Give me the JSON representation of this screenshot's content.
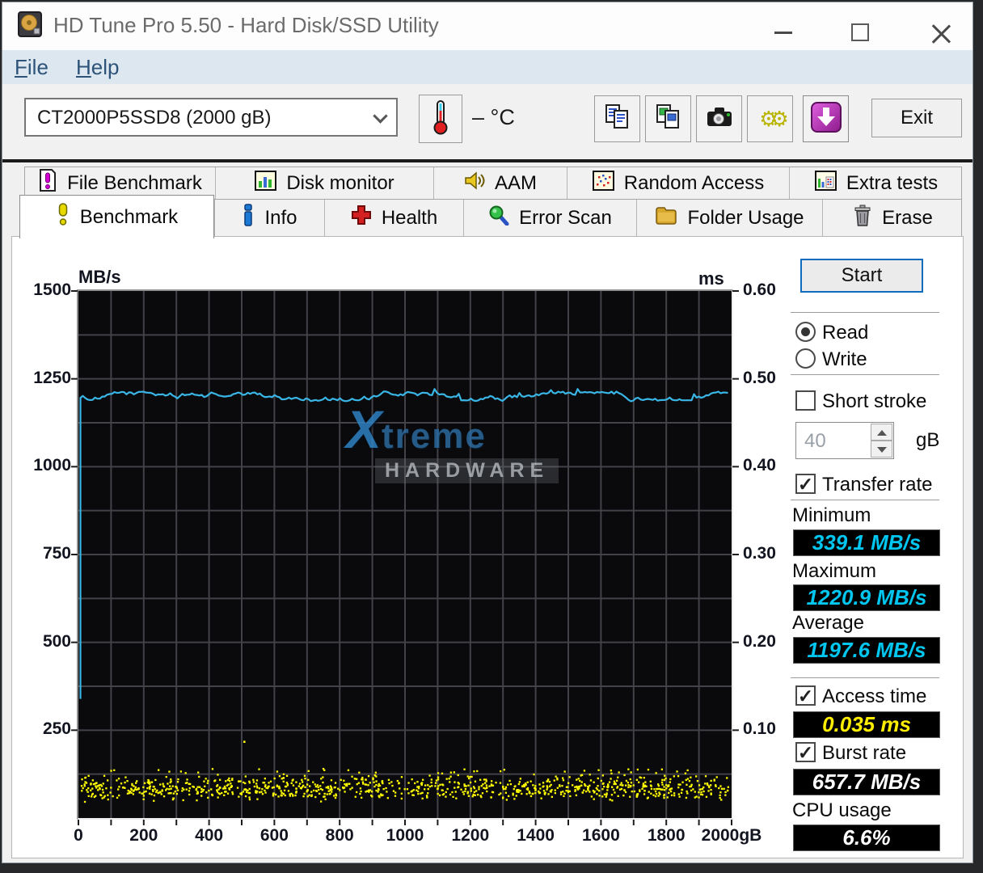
{
  "window": {
    "title": "HD Tune Pro 5.50 - Hard Disk/SSD Utility",
    "controls": [
      "minimize",
      "maximize",
      "close"
    ]
  },
  "menu": {
    "file": {
      "key": "F",
      "rest": "ile"
    },
    "help": {
      "key": "H",
      "rest": "elp"
    }
  },
  "toolbar": {
    "device": "CT2000P5SSD8 (2000 gB)",
    "temperature": "– °C",
    "exit": "Exit",
    "icons": [
      "thermometer-icon",
      "copy-report-icon",
      "copy-image-icon",
      "screenshot-icon",
      "options-icon",
      "save-results-icon"
    ]
  },
  "tabs": {
    "row1": [
      {
        "label": "File Benchmark",
        "icon": "file-benchmark-icon"
      },
      {
        "label": "Disk monitor",
        "icon": "disk-monitor-icon"
      },
      {
        "label": "AAM",
        "icon": "aam-icon"
      },
      {
        "label": "Random Access",
        "icon": "random-access-icon"
      },
      {
        "label": "Extra tests",
        "icon": "extra-tests-icon"
      }
    ],
    "row2": [
      {
        "label": "Benchmark",
        "icon": "benchmark-icon",
        "active": true
      },
      {
        "label": "Info",
        "icon": "info-icon"
      },
      {
        "label": "Health",
        "icon": "health-icon"
      },
      {
        "label": "Error Scan",
        "icon": "error-scan-icon"
      },
      {
        "label": "Folder Usage",
        "icon": "folder-usage-icon"
      },
      {
        "label": "Erase",
        "icon": "erase-icon"
      }
    ]
  },
  "controls": {
    "start": "Start",
    "read": "Read",
    "write": "Write",
    "read_selected": true,
    "short_stroke": "Short stroke",
    "short_stroke_checked": false,
    "short_stroke_value": "40",
    "short_stroke_unit": "gB",
    "transfer_rate": "Transfer rate",
    "transfer_rate_checked": true
  },
  "results": {
    "minimum": {
      "label": "Minimum",
      "value": "339.1 MB/s"
    },
    "maximum": {
      "label": "Maximum",
      "value": "1220.9 MB/s"
    },
    "average": {
      "label": "Average",
      "value": "1197.6 MB/s"
    },
    "access_time": {
      "label": "Access time",
      "value": "0.035 ms",
      "checked": true
    },
    "burst_rate": {
      "label": "Burst rate",
      "value": "657.7 MB/s",
      "checked": true
    },
    "cpu_usage": {
      "label": "CPU usage",
      "value": "6.6%"
    }
  },
  "watermark": {
    "x": "X",
    "treme": "treme",
    "hardware": "HARDWARE"
  },
  "chart_data": {
    "type": "line",
    "title": "",
    "x_axis": {
      "min": 0,
      "max": 2000,
      "unit": "gB",
      "ticks": [
        0,
        200,
        400,
        600,
        800,
        1000,
        1200,
        1400,
        1600,
        1800,
        2000
      ],
      "last_tick_label": "2000gB",
      "minor_grid_step": 100
    },
    "left_axis": {
      "label": "MB/s",
      "min": 0,
      "max": 1500,
      "ticks": [
        1500,
        1250,
        1000,
        750,
        500,
        250
      ],
      "grid_step": 125
    },
    "right_axis": {
      "label": "ms",
      "min": 0,
      "max": 0.6,
      "ticks": [
        "0.60",
        "0.50",
        "0.40",
        "0.30",
        "0.20",
        "0.10"
      ]
    },
    "grid": true,
    "plot_bg": "#0a0a0c",
    "grid_color": "#424248",
    "series": [
      {
        "name": "transfer-rate",
        "type": "line",
        "color": "#3ab6e6",
        "unit": "MB/s",
        "min": 339.1,
        "max": 1220.9,
        "average": 1197.6,
        "description": "nearly flat noisy line around 1200 MB/s across 0-2000 GB, with an initial vertical spike rising from 339 MB/s at 0 GB"
      },
      {
        "name": "access-time",
        "type": "scatter",
        "color": "#ffff00",
        "unit": "ms",
        "average": 0.035,
        "outliers": [
          {
            "x_gb": 505,
            "ms": 0.088
          }
        ],
        "description": "dense band of yellow dots around 0.035 ms across the full 0-2000 GB range"
      }
    ]
  },
  "colors": {
    "accent_blue": "#0f6cbd",
    "value_cyan": "#00c6f0",
    "value_yellow": "#ffee00",
    "value_white": "#ffffff",
    "download_purple": "#b72fb7",
    "line_cyan": "#3ab6e6",
    "dots_yellow": "#ffff00"
  }
}
